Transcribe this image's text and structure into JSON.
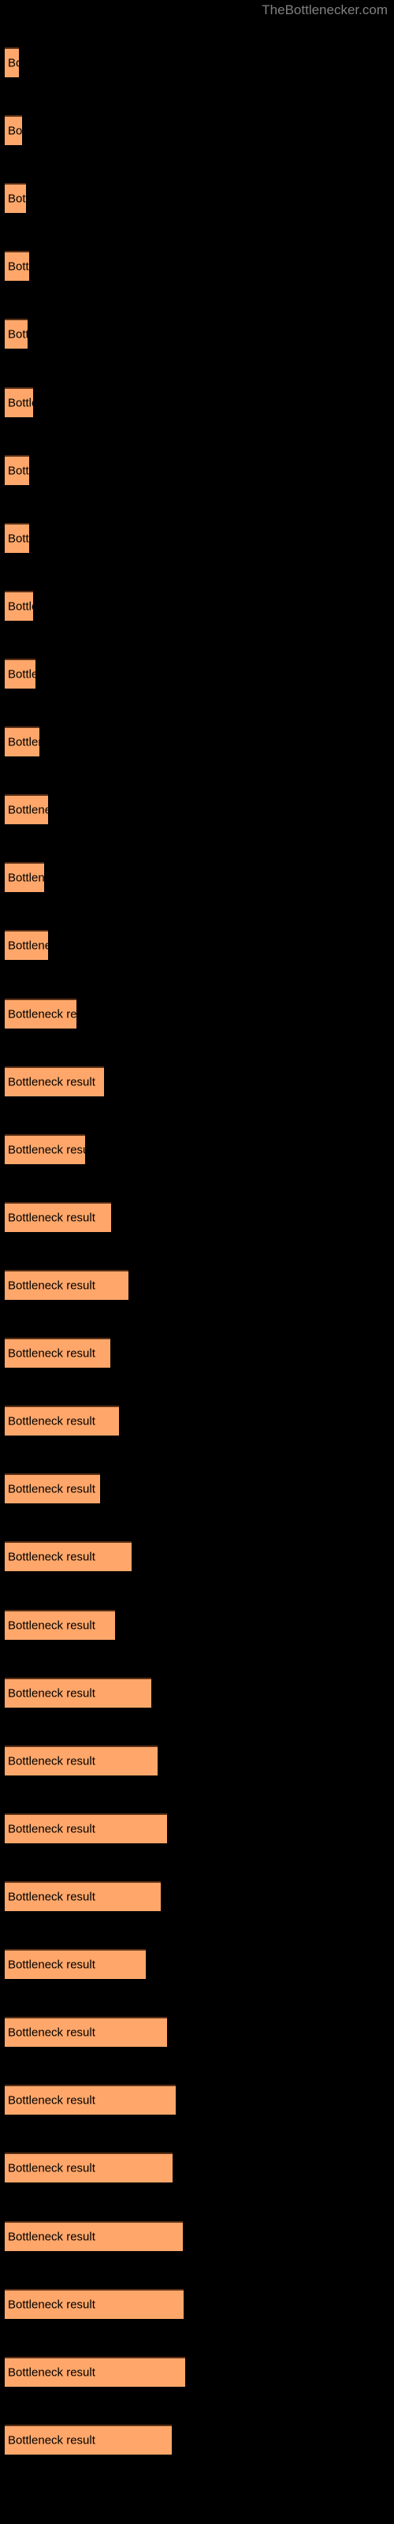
{
  "site": {
    "title": "TheBottlenecker.com",
    "title_color": "#808080"
  },
  "colors": {
    "background": "#000000",
    "bar_fill": "#ffa76a",
    "bar_border_top": "#592f16",
    "bar_label_text": "#000000"
  },
  "chart_data": {
    "type": "bar",
    "orientation": "horizontal",
    "title": "",
    "xlabel": "",
    "ylabel": "",
    "grid": false,
    "legend": false,
    "bar_label_text": "Bottleneck result",
    "categories": [
      "Bottleneck result",
      "Bottleneck result",
      "Bottleneck result",
      "Bottleneck result",
      "Bottleneck result",
      "Bottleneck result",
      "Bottleneck result",
      "Bottleneck result",
      "Bottleneck result",
      "Bottleneck result",
      "Bottleneck result",
      "Bottleneck result",
      "Bottleneck result",
      "Bottleneck result",
      "Bottleneck result",
      "Bottleneck result",
      "Bottleneck result",
      "Bottleneck result",
      "Bottleneck result",
      "Bottleneck result",
      "Bottleneck result",
      "Bottleneck result",
      "Bottleneck result",
      "Bottleneck result",
      "Bottleneck result",
      "Bottleneck result",
      "Bottleneck result",
      "Bottleneck result",
      "Bottleneck result",
      "Bottleneck result",
      "Bottleneck result",
      "Bottleneck result",
      "Bottleneck result",
      "Bottleneck result",
      "Bottleneck result",
      "Bottleneck result"
    ],
    "values": [
      18,
      22,
      27,
      31,
      29,
      36,
      31,
      31,
      36,
      39,
      44,
      55,
      50,
      55,
      91,
      126,
      102,
      135,
      157,
      134,
      145,
      121,
      161,
      140,
      186,
      194,
      206,
      198,
      179,
      206,
      217,
      213,
      226,
      227,
      229,
      212
    ],
    "xlim": [
      0,
      232
    ],
    "bar_tops": [
      60,
      147,
      190,
      234,
      277,
      320,
      364,
      407,
      451,
      494,
      537,
      581,
      624,
      667,
      711,
      754,
      797,
      841,
      884,
      927,
      971,
      1014,
      1058,
      1101,
      1144,
      1188,
      1231,
      1274,
      1318,
      1361,
      1405,
      1448,
      1491,
      1535,
      1578,
      1621
    ]
  }
}
